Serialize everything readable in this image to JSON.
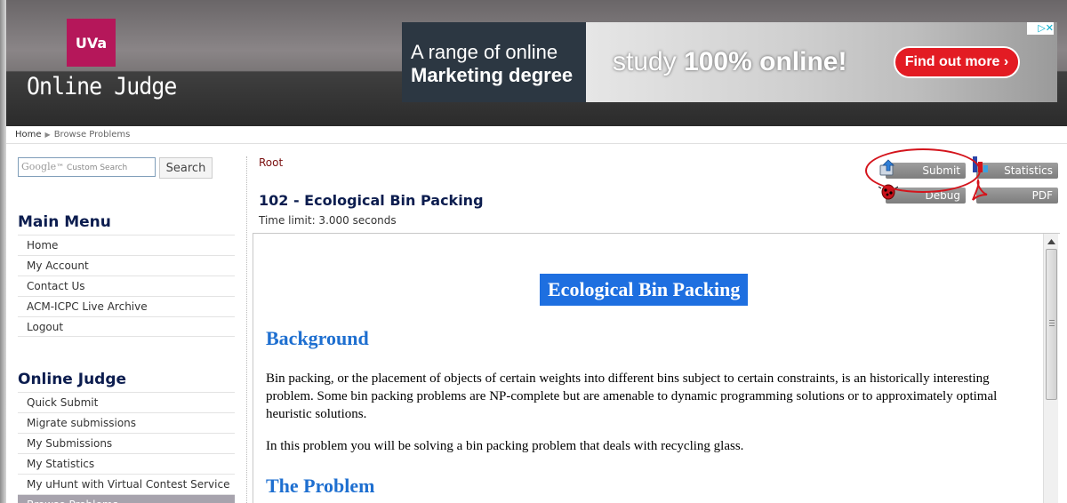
{
  "header": {
    "logo_text": "UVa",
    "site_title": "Online Judge",
    "ad": {
      "line1": "A range of online",
      "line2": "Marketing degree",
      "study_prefix": "study",
      "study_bold": "100% online!",
      "cta": "Find out more ›",
      "corner": "▷✕"
    }
  },
  "breadcrumb": {
    "home": "Home",
    "current": "Browse Problems"
  },
  "search": {
    "placeholder": "Custom Search",
    "google": "Google",
    "button": "Search"
  },
  "main_menu": {
    "title": "Main Menu",
    "items": [
      "Home",
      "My Account",
      "Contact Us",
      "ACM-ICPC Live Archive",
      "Logout"
    ]
  },
  "judge_menu": {
    "title": "Online Judge",
    "items": [
      "Quick Submit",
      "Migrate submissions",
      "My Submissions",
      "My Statistics",
      "My uHunt with Virtual Contest Service",
      "Browse Problems"
    ]
  },
  "problem": {
    "root": "Root",
    "title": "102 - Ecological Bin Packing",
    "time_limit": "Time limit: 3.000 seconds"
  },
  "tools": {
    "submit": "Submit",
    "statistics": "Statistics",
    "debug": "Debug",
    "pdf": "PDF"
  },
  "document": {
    "title": "Ecological Bin Packing",
    "background_heading": "Background",
    "background_text": "Bin packing, or the placement of objects of certain weights into different bins subject to certain constraints, is an historically interesting problem. Some bin packing problems are NP-complete but are amenable to dynamic programming solutions or to approximately optimal heuristic solutions.",
    "recycling_text": "In this problem you will be solving a bin packing problem that deals with recycling glass.",
    "problem_heading": "The Problem"
  },
  "colors": {
    "uva_red": "#b5175a",
    "heading_blue": "#1e6fd0",
    "menu_title": "#0c1d4f",
    "annotation_red": "#d4141c"
  }
}
